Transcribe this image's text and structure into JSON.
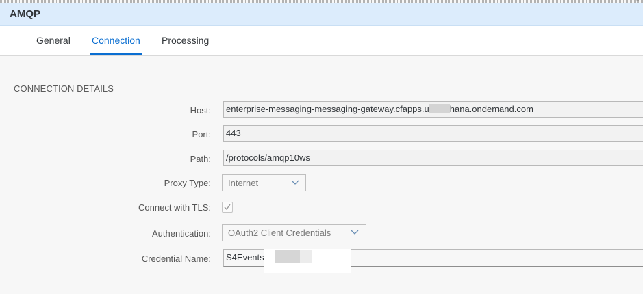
{
  "window": {
    "title": "AMQP"
  },
  "tabs": [
    {
      "label": "General",
      "active": false
    },
    {
      "label": "Connection",
      "active": true
    },
    {
      "label": "Processing",
      "active": false
    }
  ],
  "section": {
    "title": "CONNECTION DETAILS"
  },
  "fields": {
    "host": {
      "label": "Host:",
      "value_prefix": "enterprise-messaging-messaging-gateway.cfapps.u",
      "value_suffix": "hana.ondemand.com"
    },
    "port": {
      "label": "Port:",
      "value": "443"
    },
    "path": {
      "label": "Path:",
      "value": "/protocols/amqp10ws"
    },
    "proxy_type": {
      "label": "Proxy Type:",
      "value": "Internet"
    },
    "tls": {
      "label": "Connect with TLS:",
      "checked": true
    },
    "authentication": {
      "label": "Authentication:",
      "value": "OAuth2 Client Credentials"
    },
    "credential_name": {
      "label": "Credential Name:",
      "value": "S4Events"
    }
  },
  "colors": {
    "accent": "#0a6ed1",
    "title_bar": "#dcecfc",
    "background": "#f7f7f7"
  },
  "icons": {
    "dropdown": "chevron-down-icon",
    "check": "checkmark-icon"
  }
}
